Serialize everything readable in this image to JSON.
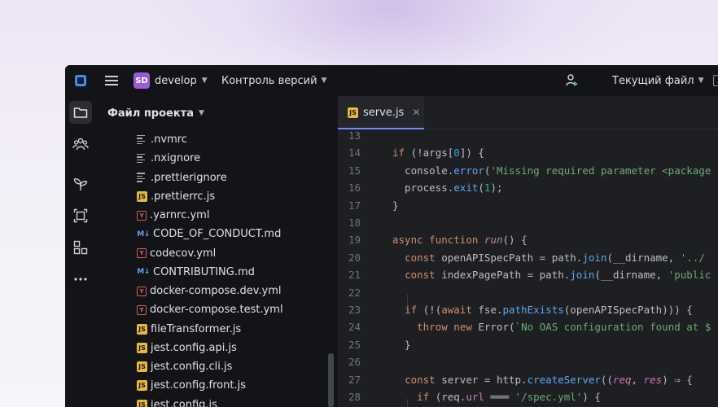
{
  "titlebar": {
    "project_initials": "SD",
    "project_name": "develop",
    "vcs_label": "Контроль версий",
    "run_config": "Текущий файл"
  },
  "panel": {
    "title": "Файл проекта",
    "files": [
      {
        "icon": "text-file-icon",
        "name": ".nvmrc"
      },
      {
        "icon": "text-file-icon",
        "name": ".nxignore"
      },
      {
        "icon": "text-file-icon",
        "name": ".prettierignore"
      },
      {
        "icon": "js-file-icon",
        "name": ".prettierrc.js"
      },
      {
        "icon": "yaml-file-icon",
        "name": ".yarnrc.yml"
      },
      {
        "icon": "markdown-file-icon",
        "name": "CODE_OF_CONDUCT.md"
      },
      {
        "icon": "yaml-file-icon",
        "name": "codecov.yml"
      },
      {
        "icon": "markdown-file-icon",
        "name": "CONTRIBUTING.md"
      },
      {
        "icon": "yaml-file-icon",
        "name": "docker-compose.dev.yml"
      },
      {
        "icon": "yaml-file-icon",
        "name": "docker-compose.test.yml"
      },
      {
        "icon": "js-file-icon",
        "name": "fileTransformer.js"
      },
      {
        "icon": "js-file-icon",
        "name": "jest.config.api.js"
      },
      {
        "icon": "js-file-icon",
        "name": "jest.config.cli.js"
      },
      {
        "icon": "js-file-icon",
        "name": "jest.config.front.js"
      },
      {
        "icon": "js-file-icon",
        "name": "jest.config.js"
      }
    ]
  },
  "editor": {
    "tab_label": "serve.js",
    "line_numbers": [
      "13",
      "14",
      "15",
      "16",
      "17",
      "18",
      "19",
      "20",
      "21",
      "22",
      "23",
      "24",
      "25",
      "26",
      "27",
      "28"
    ],
    "lines": [
      "",
      "if (!args[0]) {",
      "  console.error('Missing required parameter <package",
      "  process.exit(1);",
      "}",
      "",
      "async function run() {",
      "  const openAPISpecPath = path.join(__dirname, '../",
      "  const indexPagePath = path.join(__dirname, 'public",
      "",
      "  if (!(await fse.pathExists(openAPISpecPath))) {",
      "    throw new Error(`No OAS configuration found at $",
      "  }",
      "",
      "  const server = http.createServer((req, res) ⇒ {",
      "    if (req.url ═══ '/spec.yml') {"
    ]
  },
  "colors": {
    "accent": "#6f8cff",
    "project_badge": "#9a5bd6",
    "keyword": "#cf8e6d",
    "string": "#6aab73",
    "function": "#56a8f5"
  }
}
